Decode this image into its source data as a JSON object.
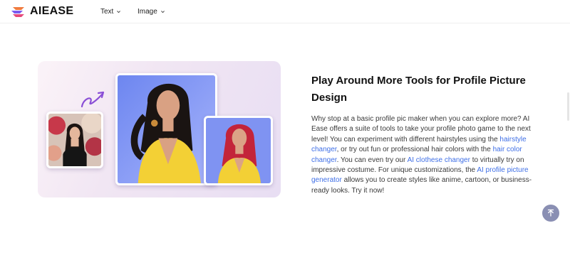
{
  "header": {
    "brand": "AIEASE",
    "nav": [
      {
        "label": "Text"
      },
      {
        "label": "Image"
      }
    ]
  },
  "section": {
    "title": "Play Around More Tools for Profile Picture Design",
    "paragraph": {
      "t1": "Why stop at a basic profile pic maker when you can explore more? AI Ease offers a suite of tools to take your profile photo game to the next level! You can experiment with different hairstyles using the ",
      "link1": "hairstyle changer",
      "t2": ", or try out fun or professional hair colors with the ",
      "link2": "hair color changer",
      "t3": ". You can even try our ",
      "link3": "AI clothese changer",
      "t4": " to virtually try on impressive costume. For unique customizations, the ",
      "link4": "AI profile picture generator",
      "t5": " allows you to create styles like anime, cartoon, or business-ready looks. Try it now!"
    }
  },
  "icons": {
    "logo": "aiease-logo-icon",
    "nav_chevron": "chevron-down-icon",
    "arrow": "curved-arrow-icon",
    "back_to_top": "arrow-up-icon"
  },
  "colors": {
    "link": "#3f6fe6",
    "accent_purple": "#8a4fd6",
    "back_to_top_bg": "#8a8fb3"
  }
}
